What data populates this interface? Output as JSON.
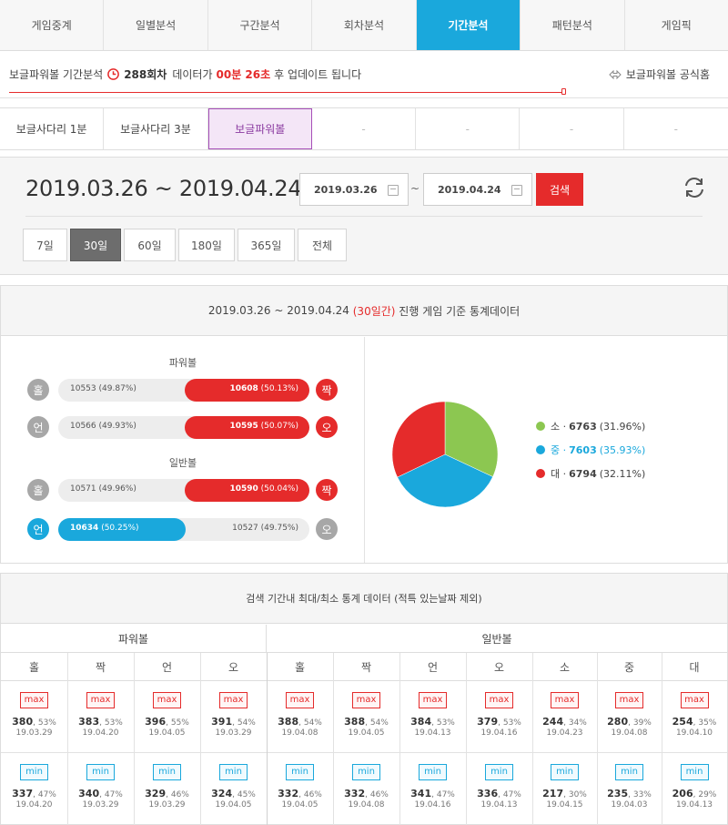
{
  "nav": {
    "tabs": [
      "게임중계",
      "일별분석",
      "구간분석",
      "회차분석",
      "기간분석",
      "패턴분석",
      "게임픽"
    ],
    "active_index": 4
  },
  "notice": {
    "prefix": "보글파워볼 기간분석",
    "round": "288회차",
    "middle": "데이터가",
    "time": "00분 26초",
    "suffix": "후 업데이트 됩니다",
    "home_link": "보글파워볼 공식홈"
  },
  "game_tabs": {
    "items": [
      "보글사다리 1분",
      "보글사다리 3분",
      "보글파워볼",
      "-",
      "-",
      "-",
      "-"
    ],
    "active_index": 2
  },
  "search": {
    "range_title": "2019.03.26 ~ 2019.04.24",
    "start_date": "2019.03.26",
    "tilde": "~",
    "end_date": "2019.04.24",
    "search_label": "검색",
    "periods": [
      "7일",
      "30일",
      "60일",
      "180일",
      "365일",
      "전체"
    ],
    "active_period_index": 1
  },
  "stats": {
    "header_prefix": "2019.03.26 ~ 2019.04.24",
    "header_highlight": "(30일간)",
    "header_suffix": "진행 게임 기준 통계데이터",
    "powerball_label": "파워볼",
    "normalball_label": "일반볼",
    "rows": [
      {
        "left_label": "홀",
        "right_label": "짝",
        "left_count": "10553",
        "left_pct": "(49.87%)",
        "right_count": "10608",
        "right_pct": "(50.13%)",
        "winner": "right",
        "win_ratio": 0.5013
      },
      {
        "left_label": "언",
        "right_label": "오",
        "left_count": "10566",
        "left_pct": "(49.93%)",
        "right_count": "10595",
        "right_pct": "(50.07%)",
        "winner": "right",
        "win_ratio": 0.5007
      },
      {
        "left_label": "홀",
        "right_label": "짝",
        "left_count": "10571",
        "left_pct": "(49.96%)",
        "right_count": "10590",
        "right_pct": "(50.04%)",
        "winner": "right",
        "win_ratio": 0.5004
      },
      {
        "left_label": "언",
        "right_label": "오",
        "left_count": "10634",
        "left_pct": "(50.25%)",
        "right_count": "10527",
        "right_pct": "(49.75%)",
        "winner": "left",
        "win_ratio": 0.5025
      }
    ],
    "colors": {
      "red": "#e52b2b",
      "blue": "#1aa8dc",
      "grey": "#a7a7a7",
      "green": "#8cc751"
    }
  },
  "chart_data": {
    "type": "pie",
    "categories": [
      "소",
      "중",
      "대"
    ],
    "values": [
      6763,
      7603,
      6794
    ],
    "percent_labels": [
      "(31.96%)",
      "(35.93%)",
      "(32.11%)"
    ],
    "value_labels": [
      "6763",
      "7603",
      "6794"
    ],
    "colors": [
      "#8cc751",
      "#1aa8dc",
      "#e52b2b"
    ],
    "legend_position": "right"
  },
  "table": {
    "title": "검색 기간내 최대/최소 통계 데이터 (적특 있는날짜 제외)",
    "group_powerball": "파워볼",
    "group_normal": "일반볼",
    "columns": [
      "홀",
      "짝",
      "언",
      "오",
      "홀",
      "짝",
      "언",
      "오",
      "소",
      "중",
      "대"
    ],
    "max_tag": "max",
    "min_tag": "min",
    "max_row": [
      {
        "v": "380",
        "p": "53%",
        "d": "19.03.29"
      },
      {
        "v": "383",
        "p": "53%",
        "d": "19.04.20"
      },
      {
        "v": "396",
        "p": "55%",
        "d": "19.04.05"
      },
      {
        "v": "391",
        "p": "54%",
        "d": "19.03.29"
      },
      {
        "v": "388",
        "p": "54%",
        "d": "19.04.08"
      },
      {
        "v": "388",
        "p": "54%",
        "d": "19.04.05"
      },
      {
        "v": "384",
        "p": "53%",
        "d": "19.04.13"
      },
      {
        "v": "379",
        "p": "53%",
        "d": "19.04.16"
      },
      {
        "v": "244",
        "p": "34%",
        "d": "19.04.23"
      },
      {
        "v": "280",
        "p": "39%",
        "d": "19.04.08"
      },
      {
        "v": "254",
        "p": "35%",
        "d": "19.04.10"
      }
    ],
    "min_row": [
      {
        "v": "337",
        "p": "47%",
        "d": "19.04.20"
      },
      {
        "v": "340",
        "p": "47%",
        "d": "19.03.29"
      },
      {
        "v": "329",
        "p": "46%",
        "d": "19.03.29"
      },
      {
        "v": "324",
        "p": "45%",
        "d": "19.04.05"
      },
      {
        "v": "332",
        "p": "46%",
        "d": "19.04.05"
      },
      {
        "v": "332",
        "p": "46%",
        "d": "19.04.08"
      },
      {
        "v": "341",
        "p": "47%",
        "d": "19.04.16"
      },
      {
        "v": "336",
        "p": "47%",
        "d": "19.04.13"
      },
      {
        "v": "217",
        "p": "30%",
        "d": "19.04.15"
      },
      {
        "v": "235",
        "p": "33%",
        "d": "19.04.03"
      },
      {
        "v": "206",
        "p": "29%",
        "d": "19.04.13"
      }
    ]
  }
}
